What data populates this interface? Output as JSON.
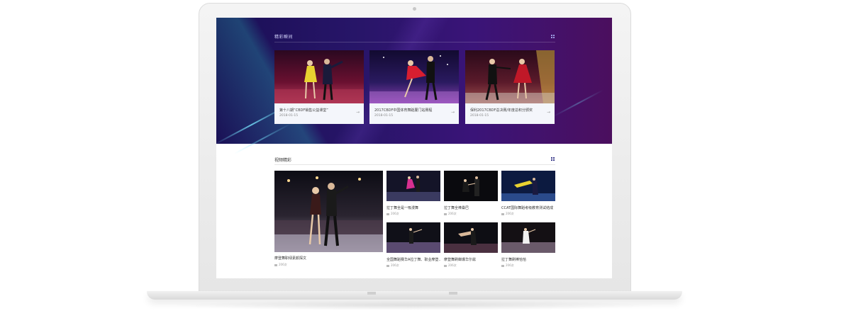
{
  "showcase": {
    "title": "精彩瞬间",
    "cards": [
      {
        "caption": "第十八期“CBDF销售公益课堂”",
        "date": "2018-01-15"
      },
      {
        "caption": "2017CBDF中国体育舞蹈厦门站赛程",
        "date": "2018-01-15"
      },
      {
        "caption": "保利2017CBDF总决赛/年度总积分颁奖",
        "date": "2018-01-15"
      }
    ]
  },
  "videos": {
    "title": "视频精彩",
    "featured": {
      "caption": "摩登舞职绿素颜探文",
      "views": "206次"
    },
    "items": [
      {
        "caption": "拉丁舞全是一吸漫舞",
        "views": "206次"
      },
      {
        "caption": "拉丁舞全棒桑巴",
        "views": "206次"
      },
      {
        "caption": "CCAT国际舞蹈考级教育测试结成",
        "views": "206次"
      },
      {
        "caption": "全国舞蹈赛华A拉丁舞、职业摩登...",
        "views": "206次"
      },
      {
        "caption": "摩登舞刷蝉爆华尔兹",
        "views": "206次"
      },
      {
        "caption": "拉丁舞刷棒恰恰",
        "views": "206次"
      }
    ]
  },
  "colors": {
    "hero_start": "#1a0f55",
    "hero_end": "#4b0f5e",
    "accent": "#3a3a8a"
  }
}
